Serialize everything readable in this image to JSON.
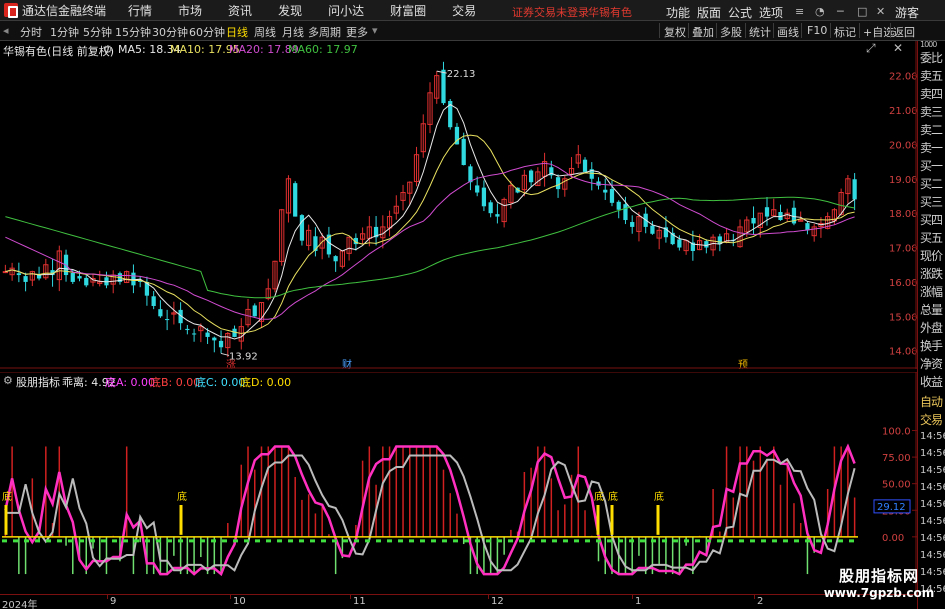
{
  "titlebar": {
    "app_title": "通达信金融终端",
    "menu": [
      "行情",
      "市场",
      "资讯",
      "发现",
      "问小达",
      "财富圈",
      "交易"
    ],
    "login_warning": "证券交易未登录",
    "stock_name": "华锡有色",
    "right_menu": [
      "功能",
      "版面",
      "公式",
      "选项"
    ],
    "guest": "游客"
  },
  "toolbar": {
    "periods": [
      "分时",
      "1分钟",
      "5分钟",
      "15分钟",
      "30分钟",
      "60分钟",
      "日线",
      "周线",
      "月线",
      "多周期",
      "更多"
    ],
    "active_period": "日线",
    "right_buttons": [
      "复权",
      "叠加",
      "多股",
      "统计",
      "画线",
      "F10",
      "标记",
      "+自选",
      "返回"
    ]
  },
  "main_chart": {
    "title": "华锡有色(日线 前复权)",
    "ma_legend": [
      {
        "label": "MA5: 18.34",
        "color": "#e8e8e8"
      },
      {
        "label": "MA10: 17.95",
        "color": "#e8e060"
      },
      {
        "label": "MA20: 17.89",
        "color": "#d04cd0"
      },
      {
        "label": "MA60: 17.97",
        "color": "#40c040"
      }
    ],
    "y_ticks": [
      "22.00",
      "21.00",
      "20.00",
      "19.00",
      "18.00",
      "17.00",
      "16.00",
      "15.00",
      "14.00"
    ],
    "high_label": "22.13",
    "low_label": "13.92",
    "markers": [
      {
        "text": "涨",
        "color": "#e03030"
      },
      {
        "text": "财",
        "color": "#4aa0ff"
      },
      {
        "text": "预",
        "color": "#e8b000"
      }
    ]
  },
  "indicator": {
    "name": "股朋指标",
    "legend": [
      {
        "label": "乖离: 4.92",
        "color": "#e8e8e8"
      },
      {
        "label": "底A: 0.00",
        "color": "#ff40ff"
      },
      {
        "label": "底B: 0.00",
        "color": "#ff4040"
      },
      {
        "label": "底C: 0.00",
        "color": "#40e0ff"
      },
      {
        "label": "底D: 0.00",
        "color": "#ffde00"
      }
    ],
    "y_ticks": [
      "100.0",
      "75.00",
      "50.00",
      "25.00",
      "0.00"
    ],
    "current_value": "29.12",
    "bottom_label": "底"
  },
  "date_axis": [
    "2024年",
    "9",
    "10",
    "11",
    "12",
    "1",
    "2"
  ],
  "right_panel": {
    "items": [
      "委比",
      "卖五",
      "卖四",
      "卖三",
      "卖二",
      "卖一",
      "买一",
      "买二",
      "买三",
      "买四",
      "买五",
      "现价",
      "涨跌",
      "涨幅",
      "总量",
      "外盘",
      "换手",
      "净资",
      "收益",
      "自动",
      "交易"
    ],
    "time_label": "14:56",
    "top_label": "1000"
  },
  "watermark": {
    "line1": "股朋指标网",
    "line2": "www.7gpzb.com"
  },
  "chart_data": {
    "type": "candlestick",
    "title": "华锡有色(日线 前复权)",
    "x_ticks": [
      "2024年",
      "9",
      "10",
      "11",
      "12",
      "1",
      "2"
    ],
    "ylim": [
      13.7,
      22.6
    ],
    "y_ticks": [
      14,
      15,
      16,
      17,
      18,
      19,
      20,
      21,
      22
    ],
    "closes": [
      16.3,
      16.4,
      16.2,
      16.0,
      16.3,
      16.1,
      16.5,
      16.2,
      16.9,
      16.2,
      16.0,
      16.1,
      15.9,
      16.1,
      16.0,
      15.9,
      16.2,
      16.0,
      16.3,
      15.9,
      16.0,
      15.6,
      15.3,
      15.0,
      14.9,
      15.1,
      14.8,
      14.6,
      14.5,
      14.7,
      14.4,
      14.3,
      14.1,
      14.5,
      14.4,
      14.7,
      15.2,
      15.0,
      15.4,
      15.8,
      16.6,
      18.1,
      19.0,
      17.9,
      17.2,
      17.5,
      16.9,
      17.3,
      16.8,
      16.6,
      16.9,
      17.3,
      17.1,
      17.4,
      17.6,
      17.3,
      17.6,
      17.9,
      18.2,
      18.6,
      18.9,
      19.7,
      20.6,
      21.5,
      22.0,
      21.2,
      20.5,
      20.0,
      19.4,
      18.9,
      18.6,
      18.2,
      18.0,
      17.9,
      18.4,
      18.8,
      18.6,
      19.1,
      18.9,
      19.2,
      19.5,
      19.1,
      18.7,
      19.0,
      19.3,
      19.7,
      19.2,
      19.0,
      18.8,
      18.6,
      18.3,
      18.1,
      17.8,
      17.6,
      17.9,
      17.6,
      17.4,
      17.5,
      17.3,
      17.1,
      17.0,
      17.2,
      16.9,
      17.2,
      17.0,
      17.3,
      17.1,
      17.4,
      17.2,
      17.6,
      17.8,
      17.7,
      18.0,
      17.9,
      18.1,
      17.8,
      18.0,
      17.7,
      17.8,
      17.5,
      17.6,
      17.7,
      17.9,
      18.1,
      18.6,
      19.0,
      18.4
    ],
    "series": [
      {
        "name": "MA5",
        "value": 18.34
      },
      {
        "name": "MA10",
        "value": 17.95
      },
      {
        "name": "MA20",
        "value": 17.89
      },
      {
        "name": "MA60",
        "value": 17.97
      }
    ],
    "indicator_ylim": [
      -50,
      140
    ],
    "indicator_ticks": [
      0,
      25,
      50,
      75,
      100
    ]
  }
}
